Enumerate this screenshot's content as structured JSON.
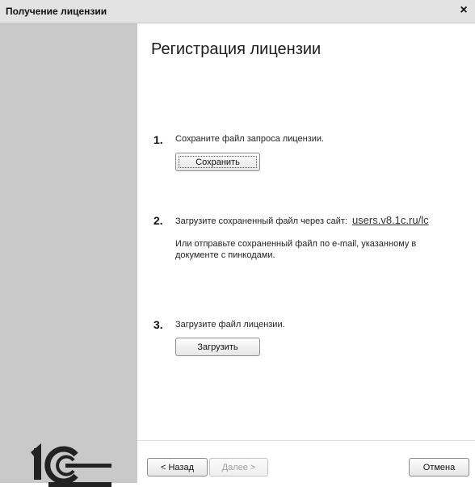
{
  "window": {
    "title": "Получение лицензии",
    "close_glyph": "×"
  },
  "main": {
    "heading": "Регистрация лицензии",
    "steps": [
      {
        "number": "1.",
        "text": "Сохраните файл запроса лицензии.",
        "button": "Сохранить"
      },
      {
        "number": "2.",
        "text": "Загрузите сохраненный файл через сайт:",
        "link": "users.v8.1c.ru/lc",
        "note_line1": "Или отправьте сохраненный файл по e-mail, указанному в",
        "note_line2": "документе с пинкодами."
      },
      {
        "number": "3.",
        "text": "Загрузите файл лицензии.",
        "button": "Загрузить"
      }
    ]
  },
  "footer": {
    "back": "< Назад",
    "next": "Далее >",
    "cancel": "Отмена"
  },
  "logo": {
    "icon": "1c-logo-icon"
  },
  "colors": {
    "sidebar": "#c9c9c9",
    "titlebar": "#e3e3e3",
    "background": "#ffffff"
  }
}
